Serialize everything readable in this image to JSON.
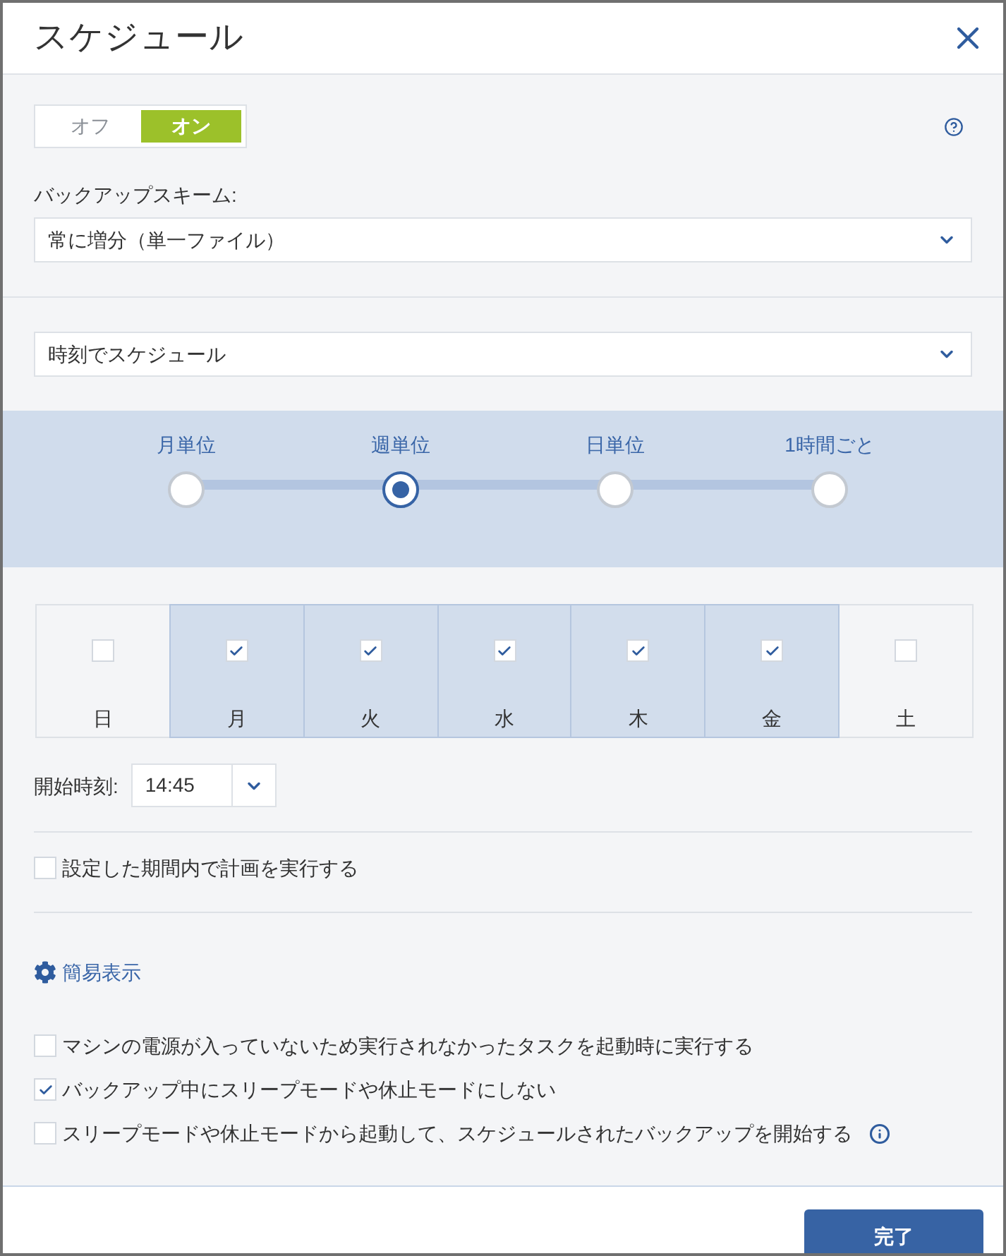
{
  "dialog": {
    "title": "スケジュール"
  },
  "schedule_toggle": [
    {
      "label": "オフ",
      "selected": false
    },
    {
      "label": "オン",
      "selected": true
    }
  ],
  "backup_scheme": {
    "label": "バックアップスキーム:",
    "value": "常に増分（単一ファイル）"
  },
  "schedule_type": {
    "value": "時刻でスケジュール"
  },
  "frequency": [
    {
      "label": "月単位",
      "selected": false
    },
    {
      "label": "週単位",
      "selected": true
    },
    {
      "label": "日単位",
      "selected": false
    },
    {
      "label": "1時間ごと",
      "selected": false
    }
  ],
  "days": [
    {
      "label": "日",
      "checked": false
    },
    {
      "label": "月",
      "checked": true
    },
    {
      "label": "火",
      "checked": true
    },
    {
      "label": "水",
      "checked": true
    },
    {
      "label": "木",
      "checked": true
    },
    {
      "label": "金",
      "checked": true
    },
    {
      "label": "土",
      "checked": false
    }
  ],
  "start_time": {
    "label": "開始時刻:",
    "value": "14:45"
  },
  "period_option": {
    "label": "設定した期間内で計画を実行する",
    "checked": false
  },
  "view_link": {
    "label": "簡易表示"
  },
  "options": [
    {
      "label": "マシンの電源が入っていないため実行されなかったタスクを起動時に実行する",
      "checked": false,
      "info_icon": false
    },
    {
      "label": "バックアップ中にスリープモードや休止モードにしない",
      "checked": true,
      "info_icon": false
    },
    {
      "label": "スリープモードや休止モードから起動して、スケジュールされたバックアップを開始する",
      "checked": false,
      "info_icon": true
    }
  ],
  "footer": {
    "buttons": [
      "完了"
    ]
  }
}
